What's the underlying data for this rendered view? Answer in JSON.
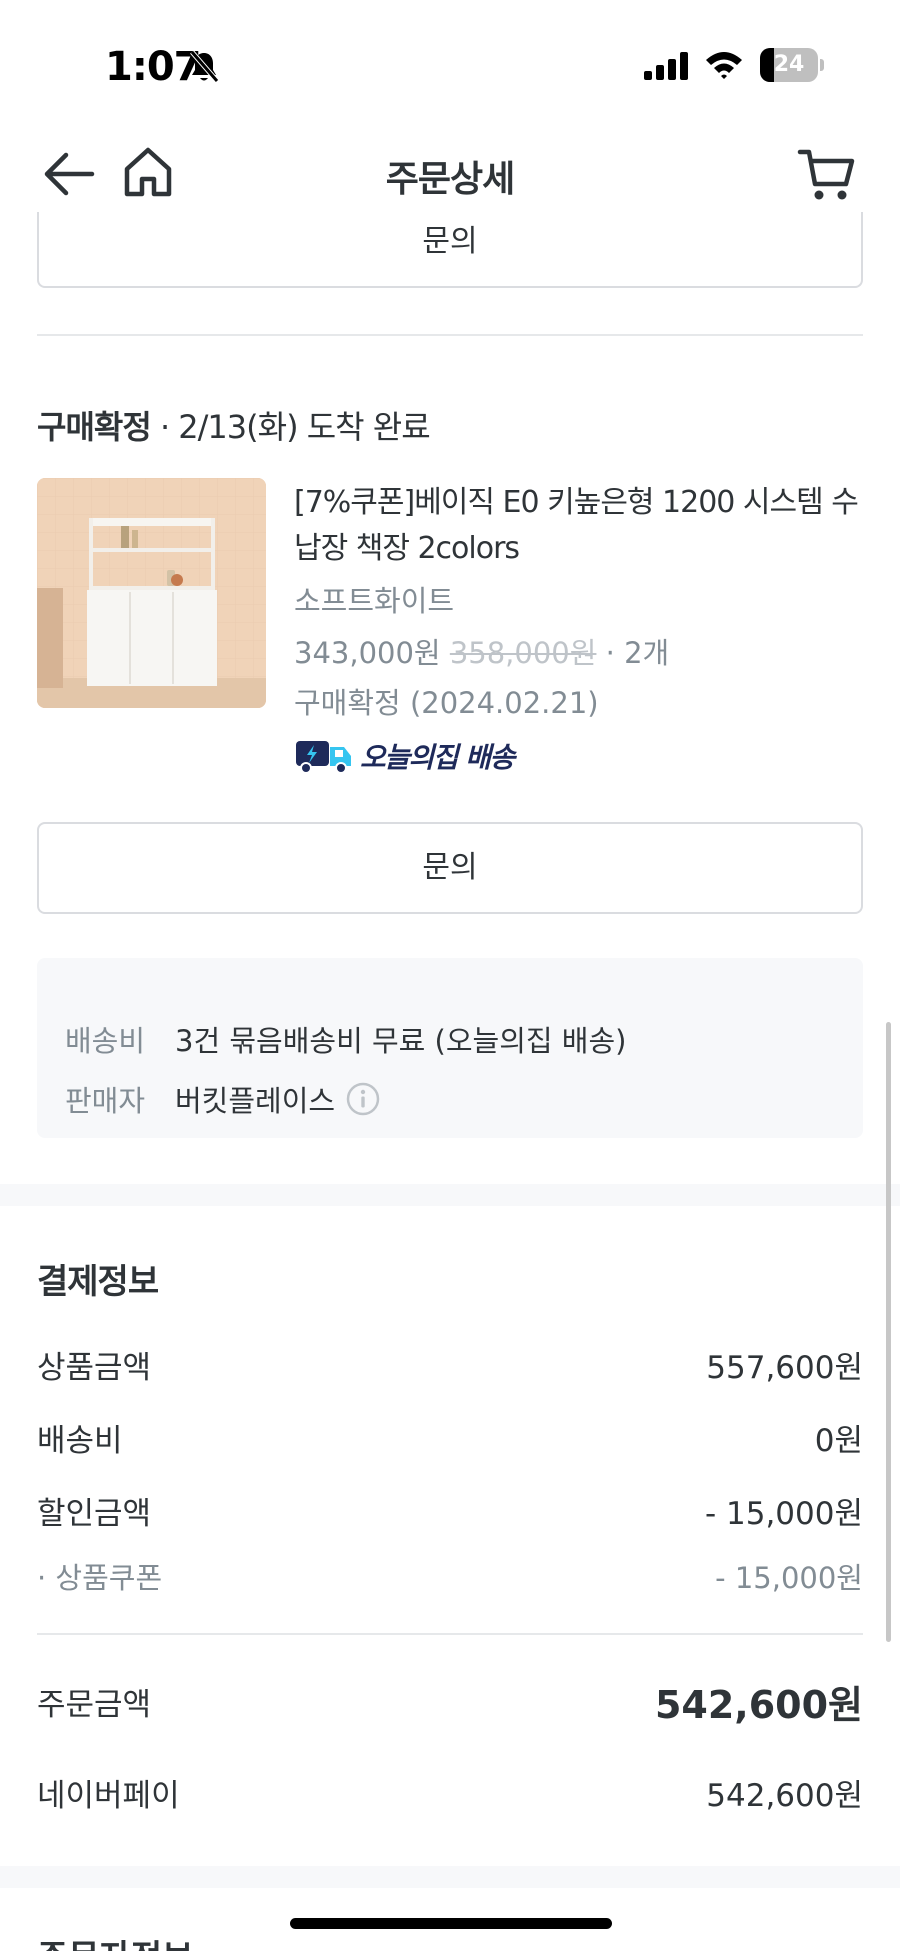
{
  "status_bar": {
    "time": "1:07",
    "battery": "24",
    "battery_level": 0.24
  },
  "nav": {
    "title": "주문상세"
  },
  "top_inquiry_label": "문의",
  "order": {
    "status_label": "구매확정",
    "status_detail": " · 2/13(화) 도착 완료"
  },
  "product": {
    "title": "[7%쿠폰]베이직 E0 키높은형 1200 시스템 수납장 책장 2colors",
    "option": "소프트화이트",
    "price": "343,000원",
    "original_price": "358,000원",
    "quantity": " · 2개",
    "confirm": "구매확정 (2024.02.21)",
    "delivery_badge": "오늘의집 배송"
  },
  "inquiry_label": "문의",
  "info": {
    "shipping_label": "배송비",
    "shipping_value": "3건 묶음배송비 무료 (오늘의집 배송)",
    "seller_label": "판매자",
    "seller_value": "버킷플레이스"
  },
  "payment": {
    "title": "결제정보",
    "product_amount_label": "상품금액",
    "product_amount": "557,600원",
    "shipping_label": "배송비",
    "shipping": "0원",
    "discount_label": "할인금액",
    "discount": "- 15,000원",
    "coupon_label": "· 상품쿠폰",
    "coupon": "- 15,000원",
    "order_total_label": "주문금액",
    "order_total": "542,600원",
    "method_label": "네이버페이",
    "method_amount": "542,600원"
  },
  "next_section_title": "주문자정보"
}
